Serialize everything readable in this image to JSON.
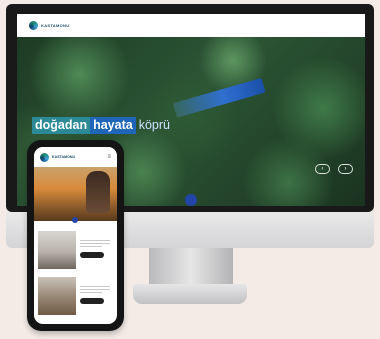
{
  "desktop": {
    "brand": "KASTAMONU",
    "nav": [
      "",
      "",
      "",
      "",
      "",
      "",
      ""
    ],
    "hero": {
      "title_part1": "doğadan",
      "title_part2": "hayata",
      "title_part3": "köprü",
      "subtitle": "",
      "prev_arrow": "‹",
      "next_arrow": "›"
    }
  },
  "mobile": {
    "brand": "KASTAMONU",
    "menu_icon": "≡",
    "hero_title": "",
    "cards": [
      {
        "title": "",
        "button": ""
      },
      {
        "title": "",
        "button": ""
      }
    ]
  },
  "colors": {
    "teal": "#2b8a95",
    "blue": "#1f66b8",
    "dot": "#2344a8",
    "background": "#f4ebe6"
  }
}
